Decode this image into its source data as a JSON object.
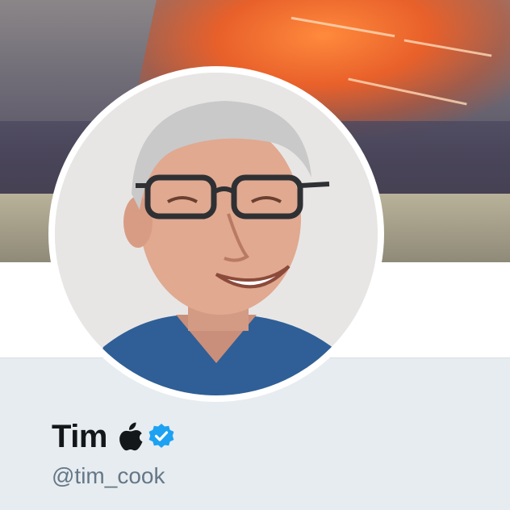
{
  "profile": {
    "display_name": "Tim",
    "handle": "@tim_cook",
    "verified": true
  },
  "icons": {
    "emoji": "apple-logo-icon",
    "badge": "verified-badge-icon"
  },
  "colors": {
    "name_text": "#14171a",
    "handle_text": "#657786",
    "verified_blue": "#1da1f2",
    "profile_background": "#e6ecf0"
  }
}
